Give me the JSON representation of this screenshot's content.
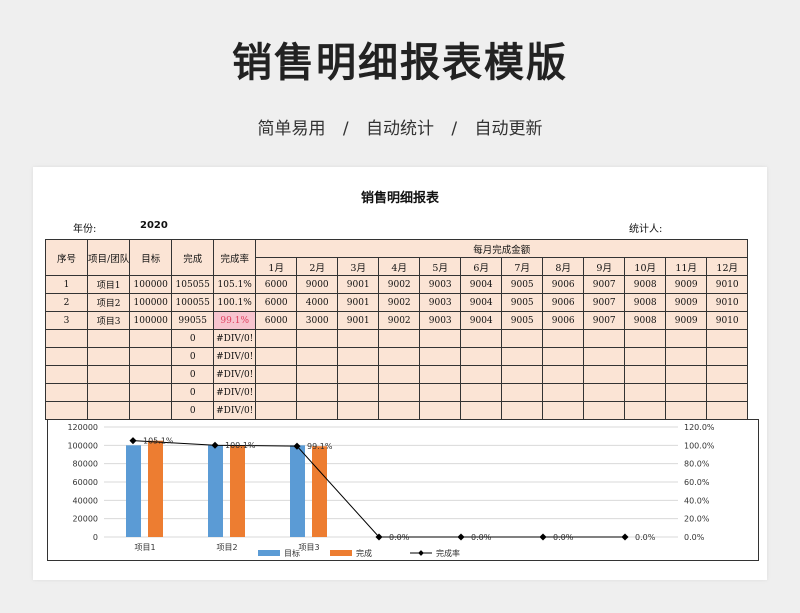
{
  "hero": {
    "title": "销售明细报表模版",
    "tags": [
      "简单易用",
      "/",
      "自动统计",
      "/",
      "自动更新"
    ]
  },
  "sheet": {
    "title": "销售明细报表",
    "year_label": "年份:",
    "year_value": "2020",
    "counter_label": "统计人:",
    "headers": {
      "seq": "序号",
      "project": "项目/团队",
      "target": "目标",
      "done": "完成",
      "rate": "完成率",
      "monthly": "每月完成金额",
      "months": [
        "1月",
        "2月",
        "3月",
        "4月",
        "5月",
        "6月",
        "7月",
        "8月",
        "9月",
        "10月",
        "11月",
        "12月"
      ]
    },
    "rows": [
      {
        "seq": "1",
        "project": "项目1",
        "target": "100000",
        "done": "105055",
        "rate": "105.1%",
        "months": [
          "6000",
          "9000",
          "9001",
          "9002",
          "9003",
          "9004",
          "9005",
          "9006",
          "9007",
          "9008",
          "9009",
          "9010"
        ]
      },
      {
        "seq": "2",
        "project": "项目2",
        "target": "100000",
        "done": "100055",
        "rate": "100.1%",
        "months": [
          "6000",
          "4000",
          "9001",
          "9002",
          "9003",
          "9004",
          "9005",
          "9006",
          "9007",
          "9008",
          "9009",
          "9010"
        ]
      },
      {
        "seq": "3",
        "project": "项目3",
        "target": "100000",
        "done": "99055",
        "rate": "99.1%",
        "months": [
          "6000",
          "3000",
          "9001",
          "9002",
          "9003",
          "9004",
          "9005",
          "9006",
          "9007",
          "9008",
          "9009",
          "9010"
        ]
      },
      {
        "seq": "",
        "project": "",
        "target": "",
        "done": "0",
        "rate": "#DIV/0!",
        "months": [
          "",
          "",
          "",
          "",
          "",
          "",
          "",
          "",
          "",
          "",
          "",
          ""
        ]
      },
      {
        "seq": "",
        "project": "",
        "target": "",
        "done": "0",
        "rate": "#DIV/0!",
        "months": [
          "",
          "",
          "",
          "",
          "",
          "",
          "",
          "",
          "",
          "",
          "",
          ""
        ]
      },
      {
        "seq": "",
        "project": "",
        "target": "",
        "done": "0",
        "rate": "#DIV/0!",
        "months": [
          "",
          "",
          "",
          "",
          "",
          "",
          "",
          "",
          "",
          "",
          "",
          ""
        ]
      },
      {
        "seq": "",
        "project": "",
        "target": "",
        "done": "0",
        "rate": "#DIV/0!",
        "months": [
          "",
          "",
          "",
          "",
          "",
          "",
          "",
          "",
          "",
          "",
          "",
          ""
        ]
      },
      {
        "seq": "",
        "project": "",
        "target": "",
        "done": "0",
        "rate": "#DIV/0!",
        "months": [
          "",
          "",
          "",
          "",
          "",
          "",
          "",
          "",
          "",
          "",
          "",
          ""
        ]
      }
    ]
  },
  "chart_data": {
    "type": "bar",
    "categories": [
      "项目1",
      "项目2",
      "项目3",
      "",
      "",
      "",
      ""
    ],
    "series": [
      {
        "name": "目标",
        "kind": "bar",
        "color": "#5b9bd5",
        "values": [
          100000,
          100000,
          100000,
          null,
          null,
          null,
          null
        ]
      },
      {
        "name": "完成",
        "kind": "bar",
        "color": "#ed7d31",
        "values": [
          105055,
          100055,
          99055,
          null,
          null,
          null,
          null
        ]
      },
      {
        "name": "完成率",
        "kind": "line",
        "color": "#000000",
        "axis": "right",
        "values": [
          1.051,
          1.001,
          0.991,
          0,
          0,
          0,
          0
        ]
      }
    ],
    "rate_labels": [
      "105.1%",
      "100.1%",
      "99.1%",
      "0.0%",
      "0.0%",
      "0.0%",
      "0.0%"
    ],
    "y_left_ticks": [
      "0",
      "20000",
      "40000",
      "60000",
      "80000",
      "100000",
      "120000"
    ],
    "y_right_ticks": [
      "0.0%",
      "20.0%",
      "40.0%",
      "60.0%",
      "80.0%",
      "100.0%",
      "120.0%"
    ],
    "ylim": [
      0,
      120000
    ],
    "ylim_right": [
      0,
      1.2
    ],
    "grid": true,
    "legend": "bottom"
  }
}
